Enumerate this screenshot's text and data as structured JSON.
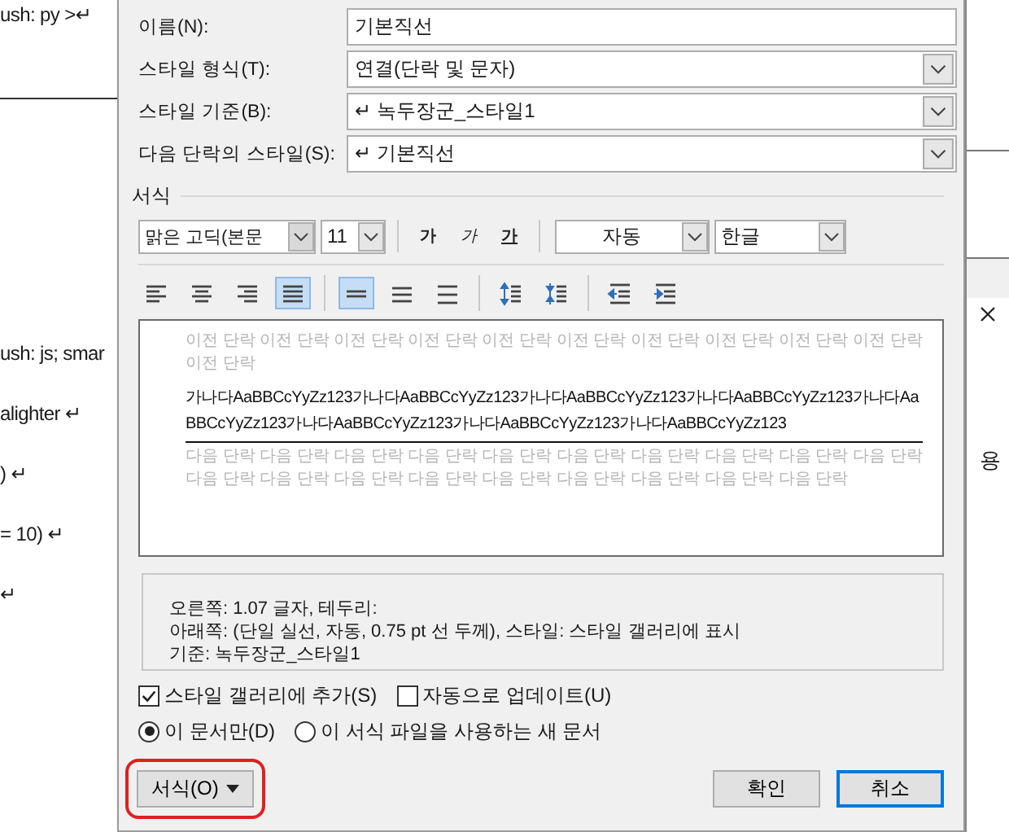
{
  "background_document": {
    "left_lines": [
      "ush: py >↵",
      "ush: js; smar",
      "alighter ↵",
      ") ↵",
      "= 10) ↵",
      "↵"
    ],
    "right_text": "용"
  },
  "dialog": {
    "fields": [
      {
        "label": "이름(N):",
        "value": "기본직선",
        "kind": "text"
      },
      {
        "label": "스타일 형식(T):",
        "value": "연결(단락 및 문자)",
        "kind": "select"
      },
      {
        "label": "스타일 기준(B):",
        "value": "↵ 녹두장군_스타일1",
        "kind": "select"
      },
      {
        "label": "다음 단락의 스타일(S):",
        "value": "↵ 기본직선",
        "kind": "select"
      }
    ],
    "format_heading": "서식",
    "font": "맑은 고딕(본문",
    "size": "11",
    "text_styles": [
      {
        "label": "가",
        "kind": "bold"
      },
      {
        "label": "가",
        "kind": "italic"
      },
      {
        "label": "가",
        "kind": "underline"
      }
    ],
    "font_color_setting": "자동",
    "language": "한글",
    "paragraph_toolbar": [
      {
        "buttons": [
          {
            "kind": "left",
            "selected": false
          },
          {
            "kind": "center",
            "selected": false
          },
          {
            "kind": "right",
            "selected": false
          },
          {
            "kind": "justify",
            "selected": true
          }
        ]
      },
      {
        "buttons": [
          {
            "kind": "single",
            "selected": true
          },
          {
            "kind": "one-half",
            "selected": false
          },
          {
            "kind": "double",
            "selected": false
          }
        ]
      },
      {
        "buttons": [
          {
            "kind": "space-more",
            "selected": false
          },
          {
            "kind": "space-less",
            "selected": false
          }
        ]
      },
      {
        "buttons": [
          {
            "kind": "indent-decrease",
            "selected": false
          },
          {
            "kind": "indent-increase",
            "selected": false
          }
        ]
      }
    ],
    "preview": {
      "previous": "이전 단락 이전 단락 이전 단락 이전 단락 이전 단락 이전 단락 이전 단락 이전 단락 이전 단락 이전 단락 이전 단락",
      "sample": "가나다AaBBCcYyZz123가나다AaBBCcYyZz123가나다AaBBCcYyZz123가나다AaBBCcYyZz123가나다AaBBCcYyZz123가나다AaBBCcYyZz123가나다AaBBCcYyZz123가나다AaBBCcYyZz123",
      "next": "다음 단락 다음 단락 다음 단락 다음 단락 다음 단락 다음 단락 다음 단락 다음 단락 다음 단락 다음 단락 다음 단락 다음 단락 다음 단락 다음 단락 다음 단락 다음 단락 다음 단락 다음 단락 다음 단락"
    },
    "description": [
      "오른쪽:  1.07 글자, 테두리:",
      "아래쪽: (단일 실선, 자동,  0.75 pt 선 두께), 스타일: 스타일 갤러리에 표시",
      "기준: 녹두장군_스타일1"
    ],
    "checkboxes": [
      {
        "label": "스타일 갤러리에 추가(S)",
        "checked": true
      },
      {
        "label": "자동으로 업데이트(U)",
        "checked": false
      }
    ],
    "radios": [
      {
        "label": "이 문서만(D)",
        "selected": true
      },
      {
        "label": "이 서식 파일을 사용하는 새 문서",
        "selected": false
      }
    ],
    "format_button": {
      "label": "서식(O)",
      "highlighted": true
    },
    "ok_button": "확인",
    "cancel_button": "취소"
  }
}
